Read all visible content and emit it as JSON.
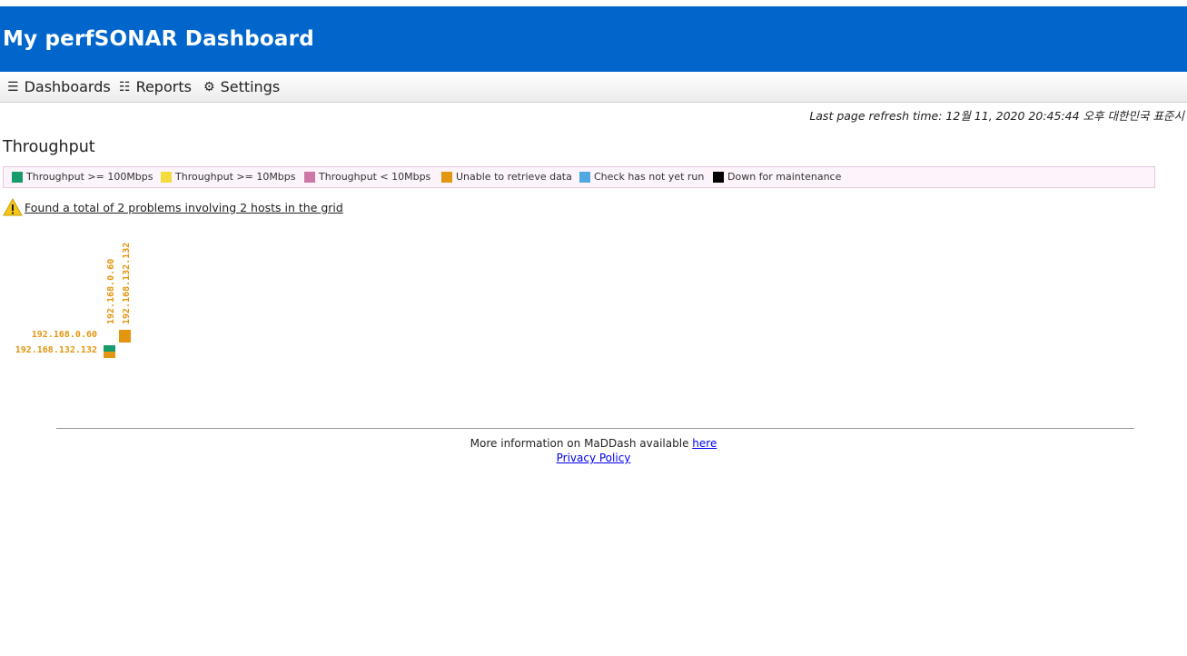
{
  "header": {
    "title": "My perfSONAR Dashboard",
    "bg_color": "#0066cc"
  },
  "menu": {
    "dashboards": {
      "icon": "list-icon",
      "label": "Dashboards"
    },
    "reports": {
      "icon": "report-icon",
      "label": "Reports"
    },
    "settings": {
      "icon": "gear-icon",
      "label": "Settings"
    }
  },
  "refresh_text": "Last page refresh time: 12월 11, 2020 20:45:44 오후 대한민국 표준시",
  "section_title": "Throughput",
  "legend": [
    {
      "label": "Throughput >= 100Mbps",
      "color": "#169b6b"
    },
    {
      "label": "Throughput >= 10Mbps",
      "color": "#f2dc3e"
    },
    {
      "label": "Throughput < 10Mbps",
      "color": "#cc77a5"
    },
    {
      "label": "Unable to retrieve data",
      "color": "#e3960f"
    },
    {
      "label": "Check has not yet run",
      "color": "#4fa8e0"
    },
    {
      "label": "Down for maintenance",
      "color": "#000000"
    }
  ],
  "problems": {
    "icon": "warning-icon",
    "text": "Found a total of 2 problems involving 2 hosts in the grid"
  },
  "grid": {
    "columns": [
      "192.168.0.60",
      "192.168.132.132"
    ],
    "rows": [
      "192.168.0.60",
      "192.168.132.132"
    ],
    "label_color": "#e3960f"
  },
  "footer": {
    "info_text": "More information on MaDDash available",
    "here_link": "here",
    "privacy_link": "Privacy Policy"
  }
}
